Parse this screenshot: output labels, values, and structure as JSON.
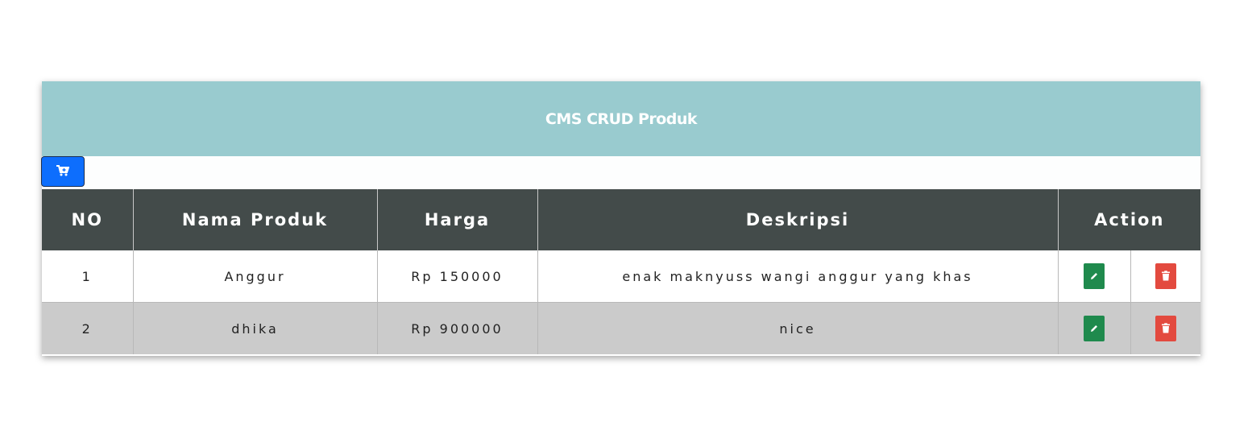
{
  "header": {
    "title": "CMS CRUD Produk"
  },
  "toolbar": {
    "add_icon": "cart-plus-icon",
    "accent": "#0d6efd"
  },
  "table": {
    "columns": [
      "NO",
      "Nama Produk",
      "Harga",
      "Deskripsi",
      "Action"
    ],
    "rows": [
      {
        "no": "1",
        "nama": "Anggur",
        "harga": "Rp 150000",
        "deskripsi": "enak maknyuss wangi anggur yang khas"
      },
      {
        "no": "2",
        "nama": "dhika",
        "harga": "Rp 900000",
        "deskripsi": "nice"
      }
    ]
  },
  "colors": {
    "header_bg": "#99cbcf",
    "table_head_bg": "#434b4a",
    "edit": "#1f8a4d",
    "delete": "#e34a3f"
  },
  "icons": {
    "edit": "pencil-icon",
    "delete": "trash-icon"
  }
}
